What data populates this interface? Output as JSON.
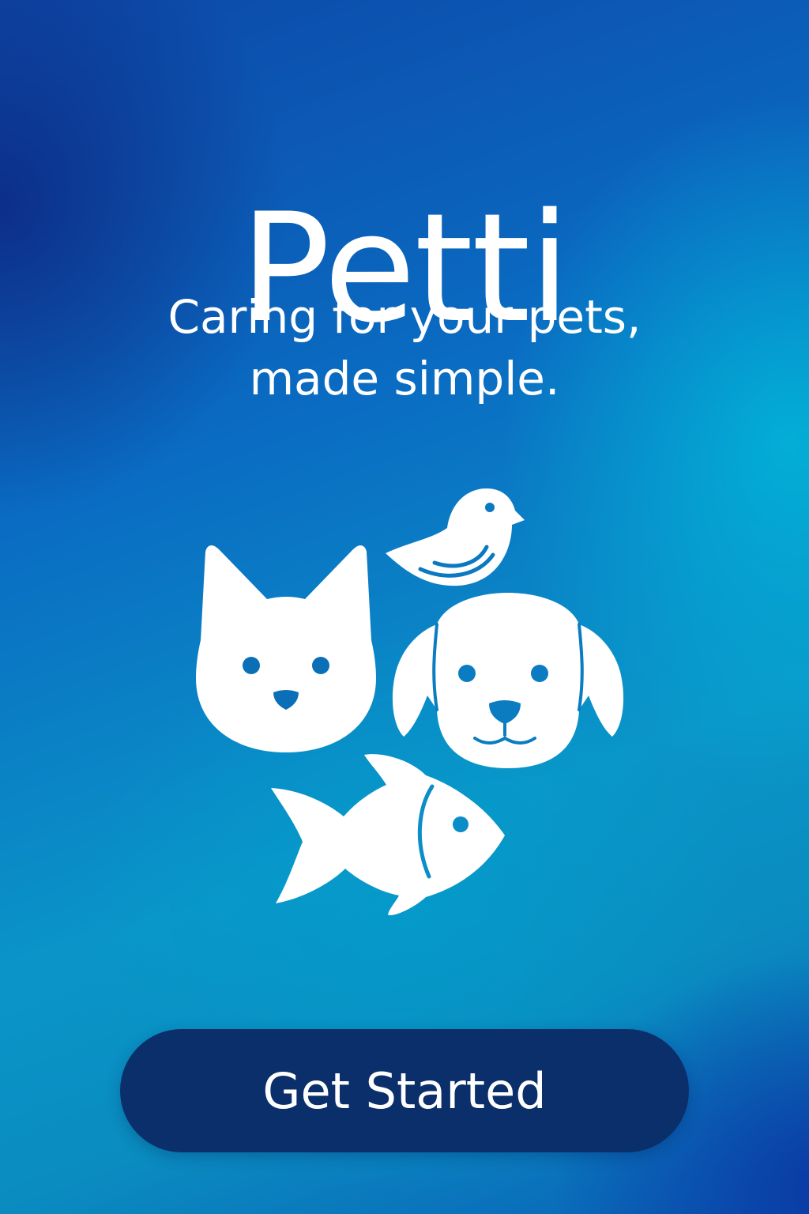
{
  "app": {
    "title": "Petti",
    "tagline_line1": "Caring for your pets,",
    "tagline_line2": "made simple."
  },
  "illustration": {
    "icons": [
      "bird-icon",
      "cat-icon",
      "dog-icon",
      "fish-icon"
    ]
  },
  "cta": {
    "label": "Get Started"
  },
  "colors": {
    "gradient_dark_blue": "#0d48a8",
    "gradient_cyan": "#0aa8d0",
    "button_navy": "#0a2f6b",
    "text_white": "#ffffff"
  }
}
